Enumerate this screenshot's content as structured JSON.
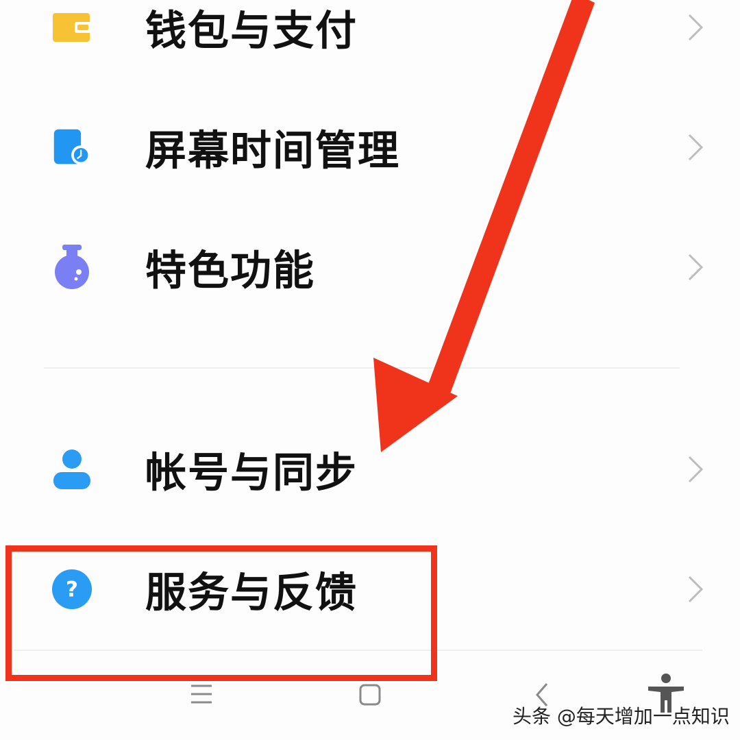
{
  "menu": {
    "items": [
      {
        "label": "钱包与支付",
        "icon": "wallet-icon",
        "color": "#f7c234"
      },
      {
        "label": "屏幕时间管理",
        "icon": "screen-time-icon",
        "color": "#2196f3"
      },
      {
        "label": "特色功能",
        "icon": "flask-icon",
        "color": "#7b7ff4"
      },
      {
        "label": "帐号与同步",
        "icon": "account-icon",
        "color": "#2b9cf3"
      },
      {
        "label": "服务与反馈",
        "icon": "help-icon",
        "color": "#2b9cf3"
      }
    ]
  },
  "annotation": {
    "highlight_target": "服务与反馈",
    "color": "#f0341c"
  },
  "navbar": {
    "items": [
      "menu-icon",
      "home-icon",
      "back-icon",
      "accessibility-icon"
    ]
  },
  "watermark": {
    "text": "头条 @每天增加一点知识"
  }
}
